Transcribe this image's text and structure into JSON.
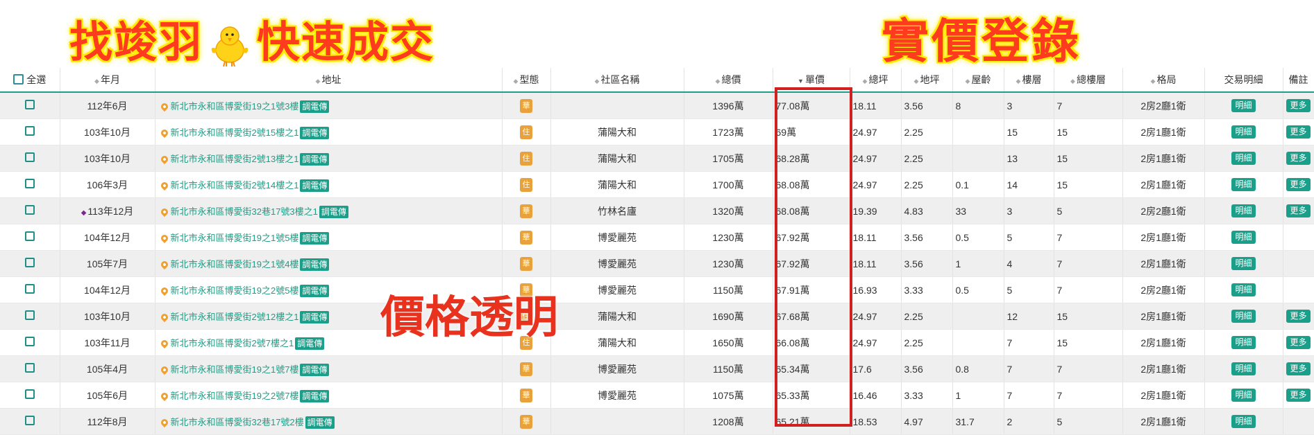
{
  "banner": {
    "left_text_a": "找竣羽",
    "left_text_b": "快速成交",
    "right_text": "實價登錄",
    "middle_overlay": "價格透明"
  },
  "table": {
    "headers": {
      "select_all": "全選",
      "year_month": "年月",
      "address": "地址",
      "type": "型態",
      "community": "社區名稱",
      "total_price": "總價",
      "unit_price": "單價",
      "total_area": "總坪",
      "land_area": "地坪",
      "age": "屋齡",
      "floor": "樓層",
      "total_floors": "總樓層",
      "layout": "格局",
      "details": "交易明細",
      "notes": "備註"
    },
    "call_label": "調電傳",
    "detail_label": "明細",
    "more_label": "更多",
    "rows": [
      {
        "ym": "112年6月",
        "addr": "新北市永和區博愛街19之1號3樓",
        "type": "華",
        "community": "",
        "total": "1396萬",
        "unit": "77.08萬",
        "area": "18.11",
        "land": "3.56",
        "age": "8",
        "floor": "3",
        "floors": "7",
        "layout": "2房2廳1衛",
        "more": true,
        "new": false
      },
      {
        "ym": "103年10月",
        "addr": "新北市永和區博愛街2號15樓之1",
        "type": "住",
        "community": "蒲陽大和",
        "total": "1723萬",
        "unit": "69萬",
        "area": "24.97",
        "land": "2.25",
        "age": "",
        "floor": "15",
        "floors": "15",
        "layout": "2房1廳1衛",
        "more": true,
        "new": false
      },
      {
        "ym": "103年10月",
        "addr": "新北市永和區博愛街2號13樓之1",
        "type": "住",
        "community": "蒲陽大和",
        "total": "1705萬",
        "unit": "68.28萬",
        "area": "24.97",
        "land": "2.25",
        "age": "",
        "floor": "13",
        "floors": "15",
        "layout": "2房1廳1衛",
        "more": true,
        "new": false
      },
      {
        "ym": "106年3月",
        "addr": "新北市永和區博愛街2號14樓之1",
        "type": "住",
        "community": "蒲陽大和",
        "total": "1700萬",
        "unit": "68.08萬",
        "area": "24.97",
        "land": "2.25",
        "age": "0.1",
        "floor": "14",
        "floors": "15",
        "layout": "2房1廳1衛",
        "more": true,
        "new": false
      },
      {
        "ym": "113年12月",
        "addr": "新北市永和區博愛街32巷17號3樓之1",
        "type": "華",
        "community": "竹林名廬",
        "total": "1320萬",
        "unit": "68.08萬",
        "area": "19.39",
        "land": "4.83",
        "age": "33",
        "floor": "3",
        "floors": "5",
        "layout": "2房2廳1衛",
        "more": true,
        "new": true
      },
      {
        "ym": "104年12月",
        "addr": "新北市永和區博愛街19之1號5樓",
        "type": "華",
        "community": "博愛麗苑",
        "total": "1230萬",
        "unit": "67.92萬",
        "area": "18.11",
        "land": "3.56",
        "age": "0.5",
        "floor": "5",
        "floors": "7",
        "layout": "2房1廳1衛",
        "more": false,
        "new": false
      },
      {
        "ym": "105年7月",
        "addr": "新北市永和區博愛街19之1號4樓",
        "type": "華",
        "community": "博愛麗苑",
        "total": "1230萬",
        "unit": "67.92萬",
        "area": "18.11",
        "land": "3.56",
        "age": "1",
        "floor": "4",
        "floors": "7",
        "layout": "2房1廳1衛",
        "more": false,
        "new": false
      },
      {
        "ym": "104年12月",
        "addr": "新北市永和區博愛街19之2號5樓",
        "type": "華",
        "community": "博愛麗苑",
        "total": "1150萬",
        "unit": "67.91萬",
        "area": "16.93",
        "land": "3.33",
        "age": "0.5",
        "floor": "5",
        "floors": "7",
        "layout": "2房2廳1衛",
        "more": false,
        "new": false
      },
      {
        "ym": "103年10月",
        "addr": "新北市永和區博愛街2號12樓之1",
        "type": "住",
        "community": "蒲陽大和",
        "total": "1690萬",
        "unit": "67.68萬",
        "area": "24.97",
        "land": "2.25",
        "age": "",
        "floor": "12",
        "floors": "15",
        "layout": "2房1廳1衛",
        "more": true,
        "new": false
      },
      {
        "ym": "103年11月",
        "addr": "新北市永和區博愛街2號7樓之1",
        "type": "住",
        "community": "蒲陽大和",
        "total": "1650萬",
        "unit": "66.08萬",
        "area": "24.97",
        "land": "2.25",
        "age": "",
        "floor": "7",
        "floors": "15",
        "layout": "2房1廳1衛",
        "more": true,
        "new": false
      },
      {
        "ym": "105年4月",
        "addr": "新北市永和區博愛街19之1號7樓",
        "type": "華",
        "community": "博愛麗苑",
        "total": "1150萬",
        "unit": "65.34萬",
        "area": "17.6",
        "land": "3.56",
        "age": "0.8",
        "floor": "7",
        "floors": "7",
        "layout": "2房1廳1衛",
        "more": true,
        "new": false
      },
      {
        "ym": "105年6月",
        "addr": "新北市永和區博愛街19之2號7樓",
        "type": "華",
        "community": "博愛麗苑",
        "total": "1075萬",
        "unit": "65.33萬",
        "area": "16.46",
        "land": "3.33",
        "age": "1",
        "floor": "7",
        "floors": "7",
        "layout": "2房1廳1衛",
        "more": true,
        "new": false
      },
      {
        "ym": "112年8月",
        "addr": "新北市永和區博愛街32巷17號2樓",
        "type": "華",
        "community": "",
        "total": "1208萬",
        "unit": "65.21萬",
        "area": "18.53",
        "land": "4.97",
        "age": "31.7",
        "floor": "2",
        "floors": "5",
        "layout": "2房1廳1衛",
        "more": false,
        "new": false
      }
    ]
  }
}
